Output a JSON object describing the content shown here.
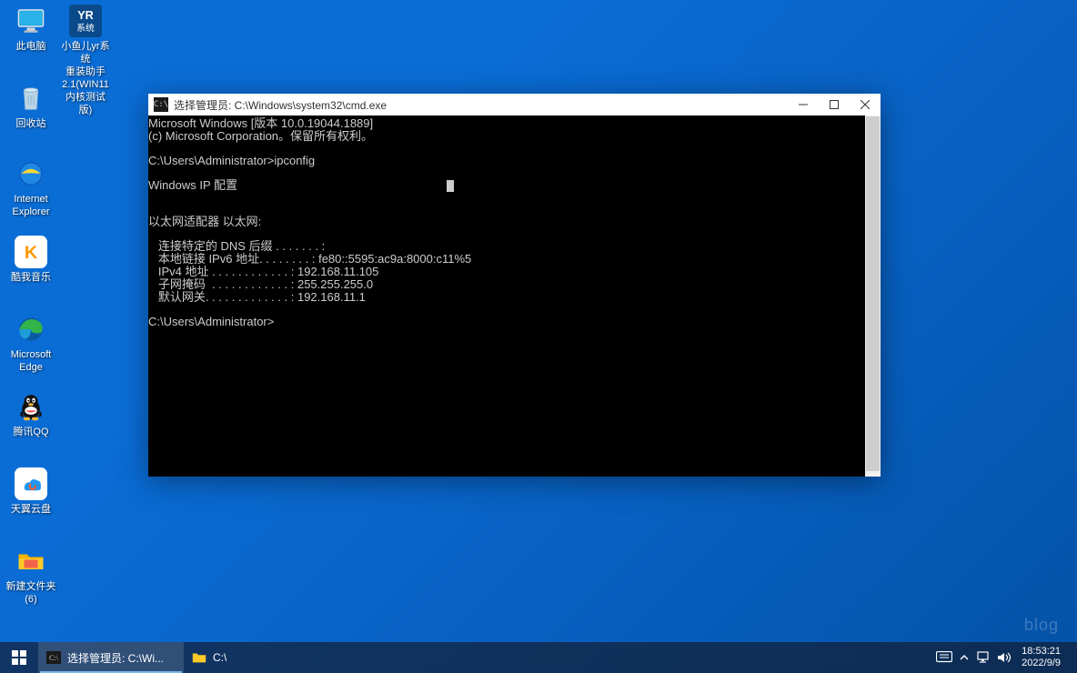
{
  "desktop": {
    "icons": [
      {
        "label": "此电脑"
      },
      {
        "label": "小鱼儿yr系统\n重装助手\n2.1(WIN11\n内核测试版)"
      },
      {
        "label": "回收站"
      },
      {
        "label": "Internet\nExplorer"
      },
      {
        "label": "酷我音乐"
      },
      {
        "label": "Microsoft\nEdge"
      },
      {
        "label": "腾讯QQ"
      },
      {
        "label": "天翼云盘"
      },
      {
        "label": "新建文件夹\n(6)"
      }
    ]
  },
  "cmd": {
    "title": "选择管理员: C:\\Windows\\system32\\cmd.exe",
    "line1": "Microsoft Windows [版本 10.0.19044.1889]",
    "line2": "(c) Microsoft Corporation。保留所有权利。",
    "prompt1": "C:\\Users\\Administrator>ipconfig",
    "header": "Windows IP 配置",
    "adapter": "以太网适配器 以太网:",
    "dns_lbl": "   连接特定的 DNS 后缀 . . . . . . . :",
    "ipv6_lbl": "   本地链接 IPv6 地址. . . . . . . . : ",
    "ipv6_val": "fe80::5595:ac9a:8000:c11%5",
    "ipv4_lbl": "   IPv4 地址 . . . . . . . . . . . . : ",
    "ipv4_val": "192.168.11.105",
    "mask_lbl": "   子网掩码  . . . . . . . . . . . . : ",
    "mask_val": "255.255.255.0",
    "gw_lbl": "   默认网关. . . . . . . . . . . . . : ",
    "gw_val": "192.168.11.1",
    "prompt2": "C:\\Users\\Administrator>"
  },
  "taskbar": {
    "cmd_label": "选择管理员: C:\\Wi...",
    "explorer_label": "C:\\"
  },
  "tray": {
    "time": "18:53:21",
    "date": "2022/9/9"
  },
  "watermark": "blog"
}
